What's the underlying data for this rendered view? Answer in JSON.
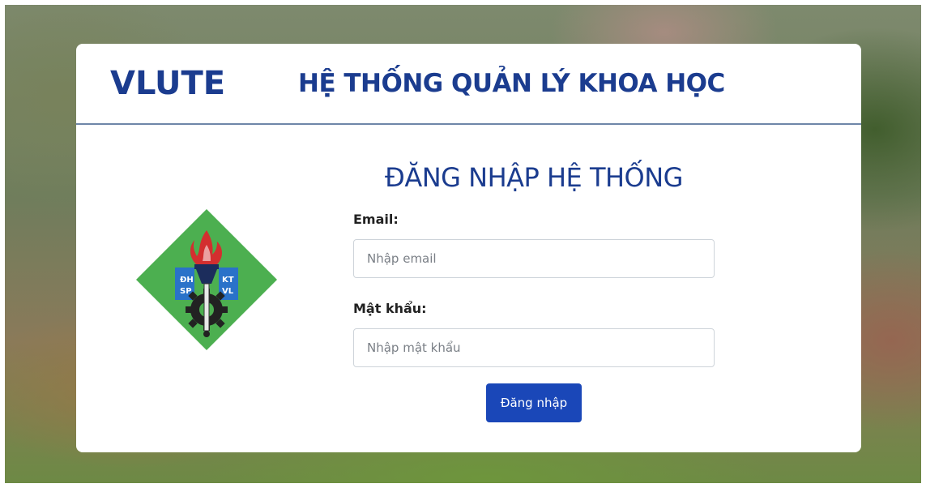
{
  "header": {
    "brand": "VLUTE",
    "title": "HỆ THỐNG QUẢN LÝ KHOA HỌC"
  },
  "logo": {
    "top_left": "ĐH",
    "bottom_left": "SP",
    "top_right": "KT",
    "bottom_right": "VL",
    "color_primary": "#4caf50",
    "color_flame": "#d32f2f",
    "color_gear": "#222222"
  },
  "login": {
    "title": "ĐĂNG NHẬP HỆ THỐNG",
    "email_label": "Email:",
    "email_placeholder": "Nhập email",
    "email_value": "",
    "password_label": "Mật khẩu:",
    "password_placeholder": "Nhập mật khẩu",
    "password_value": "",
    "submit_label": "Đăng nhập"
  },
  "colors": {
    "brand_blue": "#1b3c8f",
    "button_blue": "#1a47b8",
    "divider": "#6e86a8"
  }
}
